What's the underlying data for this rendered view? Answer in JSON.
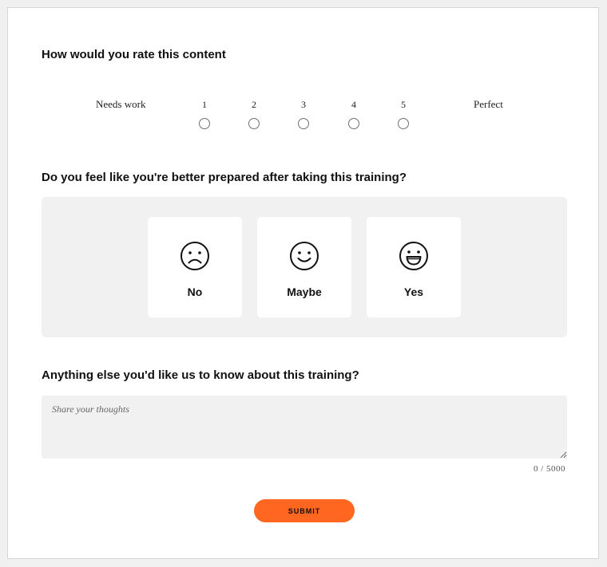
{
  "rating": {
    "question": "How would you rate this content",
    "low_label": "Needs work",
    "high_label": "Perfect",
    "options": [
      "1",
      "2",
      "3",
      "4",
      "5"
    ]
  },
  "prepared": {
    "question": "Do you feel like you're better prepared after taking this training?",
    "options": [
      {
        "label": "No",
        "icon": "sad-face-icon"
      },
      {
        "label": "Maybe",
        "icon": "smile-face-icon"
      },
      {
        "label": "Yes",
        "icon": "grin-face-icon"
      }
    ]
  },
  "feedback": {
    "question": "Anything else you'd like us to know about this training?",
    "placeholder": "Share your thoughts",
    "value": "",
    "counter": "0 / 5000"
  },
  "submit_label": "SUBMIT",
  "colors": {
    "accent": "#ff6620",
    "panel": "#f1f1f1",
    "card": "#ffffff",
    "background": "#f0f0f0"
  }
}
